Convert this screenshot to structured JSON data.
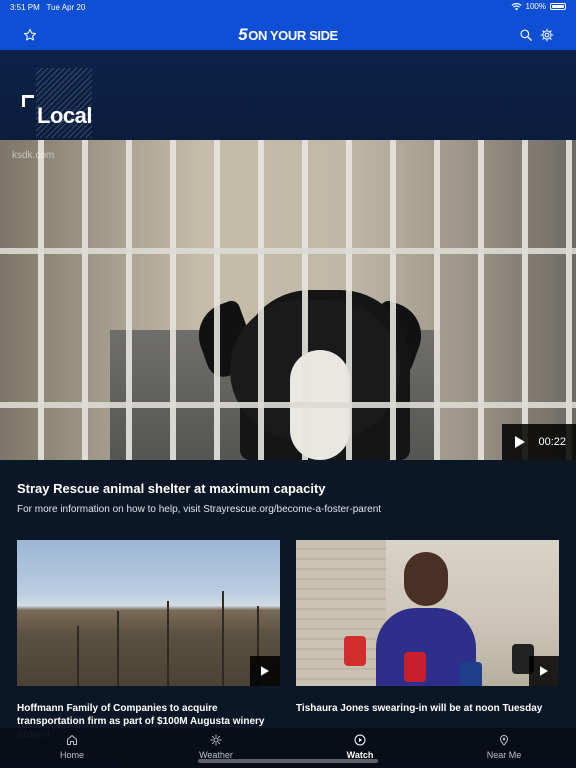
{
  "status_bar": {
    "time": "3:51 PM",
    "date": "Tue Apr 20",
    "battery": "100%",
    "battery_level": 1.0
  },
  "nav": {
    "logo_number": "5",
    "logo_text": "ON YOUR SIDE",
    "icons": [
      "star-icon",
      "search-icon",
      "gear-icon"
    ]
  },
  "section": {
    "title": "Local"
  },
  "hero": {
    "watermark": "ksdk.com",
    "duration": "00:22",
    "title": "Stray Rescue animal shelter at maximum capacity",
    "subtitle": "For more information on how to help, visit Strayrescue.org/become-a-foster-parent"
  },
  "cards": [
    {
      "title": "Hoffmann Family of Companies to acquire transportation firm as part of $100M Augusta winery project"
    },
    {
      "title": "Tishaura Jones swearing-in will be at noon Tuesday"
    }
  ],
  "tabs": [
    {
      "label": "Home",
      "icon": "home-icon",
      "active": false
    },
    {
      "label": "Weather",
      "icon": "sun-icon",
      "active": false
    },
    {
      "label": "Watch",
      "icon": "play-circle-icon",
      "active": true
    },
    {
      "label": "Near Me",
      "icon": "location-pin-icon",
      "active": false
    }
  ],
  "colors": {
    "brand_blue": "#0f4fd6",
    "banner_navy": "#0d2248",
    "background": "#0b1726"
  }
}
